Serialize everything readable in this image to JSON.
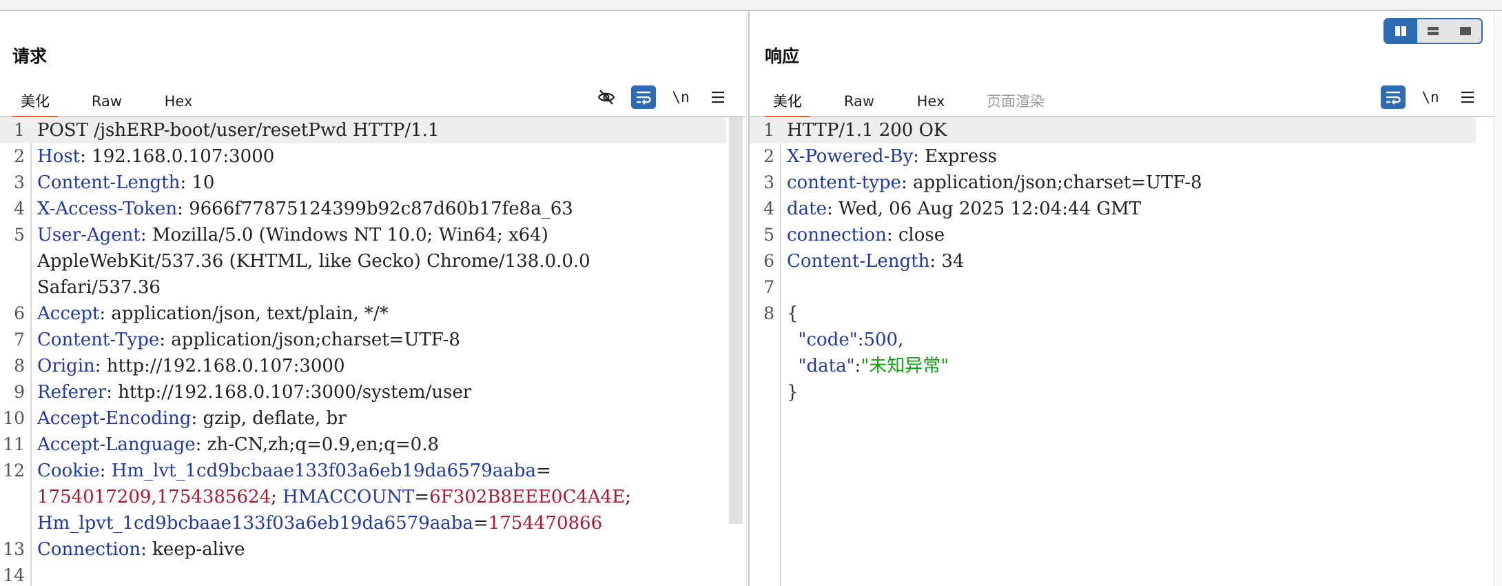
{
  "layout_toggle": {
    "active": "side-by-side",
    "options": [
      "side-by-side-icon",
      "stacked-icon",
      "single-icon"
    ]
  },
  "request": {
    "title": "请求",
    "tabs": [
      {
        "label": "美化",
        "active": true
      },
      {
        "label": "Raw"
      },
      {
        "label": "Hex"
      }
    ],
    "tools": [
      "hide-icon",
      "wrap-icon",
      "newline-icon",
      "menu-icon"
    ],
    "newline_label": "\\n",
    "lines": [
      {
        "n": "1",
        "parts": [
          {
            "t": "POST /jshERP-boot/user/resetPwd HTTP/1.1",
            "c": "v"
          }
        ],
        "hl": true
      },
      {
        "n": "2",
        "parts": [
          {
            "t": "Host",
            "c": "k"
          },
          {
            "t": ": 192.168.0.107:3000",
            "c": "v"
          }
        ]
      },
      {
        "n": "3",
        "parts": [
          {
            "t": "Content-Length",
            "c": "k"
          },
          {
            "t": ": 10",
            "c": "v"
          }
        ]
      },
      {
        "n": "4",
        "parts": [
          {
            "t": "X-Access-Token",
            "c": "k"
          },
          {
            "t": ": 9666f77875124399b92c87d60b17fe8a_63",
            "c": "v"
          }
        ]
      },
      {
        "n": "5",
        "parts": [
          {
            "t": "User-Agent",
            "c": "k"
          },
          {
            "t": ": Mozilla/5.0 (Windows NT 10.0; Win64; x64)",
            "c": "v"
          }
        ]
      },
      {
        "n": "",
        "parts": [
          {
            "t": "AppleWebKit/537.36 (KHTML, like Gecko) Chrome/138.0.0.0",
            "c": "v"
          }
        ]
      },
      {
        "n": "",
        "parts": [
          {
            "t": "Safari/537.36",
            "c": "v"
          }
        ]
      },
      {
        "n": "6",
        "parts": [
          {
            "t": "Accept",
            "c": "k"
          },
          {
            "t": ": application/json, text/plain, */*",
            "c": "v"
          }
        ]
      },
      {
        "n": "7",
        "parts": [
          {
            "t": "Content-Type",
            "c": "k"
          },
          {
            "t": ": application/json;charset=UTF-8",
            "c": "v"
          }
        ]
      },
      {
        "n": "8",
        "parts": [
          {
            "t": "Origin",
            "c": "k"
          },
          {
            "t": ": http://192.168.0.107:3000",
            "c": "v"
          }
        ]
      },
      {
        "n": "9",
        "parts": [
          {
            "t": "Referer",
            "c": "k"
          },
          {
            "t": ": http://192.168.0.107:3000/system/user",
            "c": "v"
          }
        ]
      },
      {
        "n": "10",
        "parts": [
          {
            "t": "Accept-Encoding",
            "c": "k"
          },
          {
            "t": ": gzip, deflate, br",
            "c": "v"
          }
        ]
      },
      {
        "n": "11",
        "parts": [
          {
            "t": "Accept-Language",
            "c": "k"
          },
          {
            "t": ": zh-CN,zh;q=0.9,en;q=0.8",
            "c": "v"
          }
        ]
      },
      {
        "n": "12",
        "parts": [
          {
            "t": "Cookie",
            "c": "k"
          },
          {
            "t": ": ",
            "c": "v"
          },
          {
            "t": "Hm_lvt_1cd9bcbaae133f03a6eb19da6579aaba",
            "c": "ck"
          },
          {
            "t": "=",
            "c": "cs"
          }
        ]
      },
      {
        "n": "",
        "parts": [
          {
            "t": "1754017209,1754385624",
            "c": "cv"
          },
          {
            "t": "; ",
            "c": "cs"
          },
          {
            "t": "HMACCOUNT",
            "c": "ck"
          },
          {
            "t": "=",
            "c": "cs"
          },
          {
            "t": "6F302B8EEE0C4A4E",
            "c": "cv"
          },
          {
            "t": ";",
            "c": "cs"
          }
        ]
      },
      {
        "n": "",
        "parts": [
          {
            "t": "Hm_lpvt_1cd9bcbaae133f03a6eb19da6579aaba",
            "c": "ck"
          },
          {
            "t": "=",
            "c": "cs"
          },
          {
            "t": "1754470866",
            "c": "cv"
          }
        ]
      },
      {
        "n": "13",
        "parts": [
          {
            "t": "Connection",
            "c": "k"
          },
          {
            "t": ": keep-alive",
            "c": "v"
          }
        ]
      },
      {
        "n": "14",
        "parts": []
      }
    ]
  },
  "response": {
    "title": "响应",
    "tabs": [
      {
        "label": "美化",
        "active": true
      },
      {
        "label": "Raw"
      },
      {
        "label": "Hex"
      },
      {
        "label": "页面渲染",
        "disabled": true
      }
    ],
    "tools": [
      "wrap-icon",
      "newline-icon",
      "menu-icon"
    ],
    "newline_label": "\\n",
    "lines": [
      {
        "n": "1",
        "parts": [
          {
            "t": "HTTP/1.1 200 OK",
            "c": "v"
          }
        ],
        "hl": true
      },
      {
        "n": "2",
        "parts": [
          {
            "t": "X-Powered-By",
            "c": "k"
          },
          {
            "t": ": Express",
            "c": "v"
          }
        ]
      },
      {
        "n": "3",
        "parts": [
          {
            "t": "content-type",
            "c": "k"
          },
          {
            "t": ": application/json;charset=UTF-8",
            "c": "v"
          }
        ]
      },
      {
        "n": "4",
        "parts": [
          {
            "t": "date",
            "c": "k"
          },
          {
            "t": ": Wed, 06 Aug 2025 12:04:44 GMT",
            "c": "v"
          }
        ]
      },
      {
        "n": "5",
        "parts": [
          {
            "t": "connection",
            "c": "k"
          },
          {
            "t": ": close",
            "c": "v"
          }
        ]
      },
      {
        "n": "6",
        "parts": [
          {
            "t": "Content-Length",
            "c": "k"
          },
          {
            "t": ": 34",
            "c": "v"
          }
        ]
      },
      {
        "n": "7",
        "parts": []
      },
      {
        "n": "8",
        "parts": [
          {
            "t": "{",
            "c": "jp"
          }
        ]
      },
      {
        "n": "",
        "parts": [
          {
            "t": "  ",
            "c": "jp"
          },
          {
            "t": "\"code\"",
            "c": "jk"
          },
          {
            "t": ":",
            "c": "jp"
          },
          {
            "t": "500",
            "c": "jn"
          },
          {
            "t": ",",
            "c": "jp"
          }
        ]
      },
      {
        "n": "",
        "parts": [
          {
            "t": "  ",
            "c": "jp"
          },
          {
            "t": "\"data\"",
            "c": "jk"
          },
          {
            "t": ":",
            "c": "jp"
          },
          {
            "t": "\"未知异常\"",
            "c": "js"
          }
        ]
      },
      {
        "n": "",
        "parts": [
          {
            "t": "}",
            "c": "jp"
          }
        ]
      }
    ]
  }
}
